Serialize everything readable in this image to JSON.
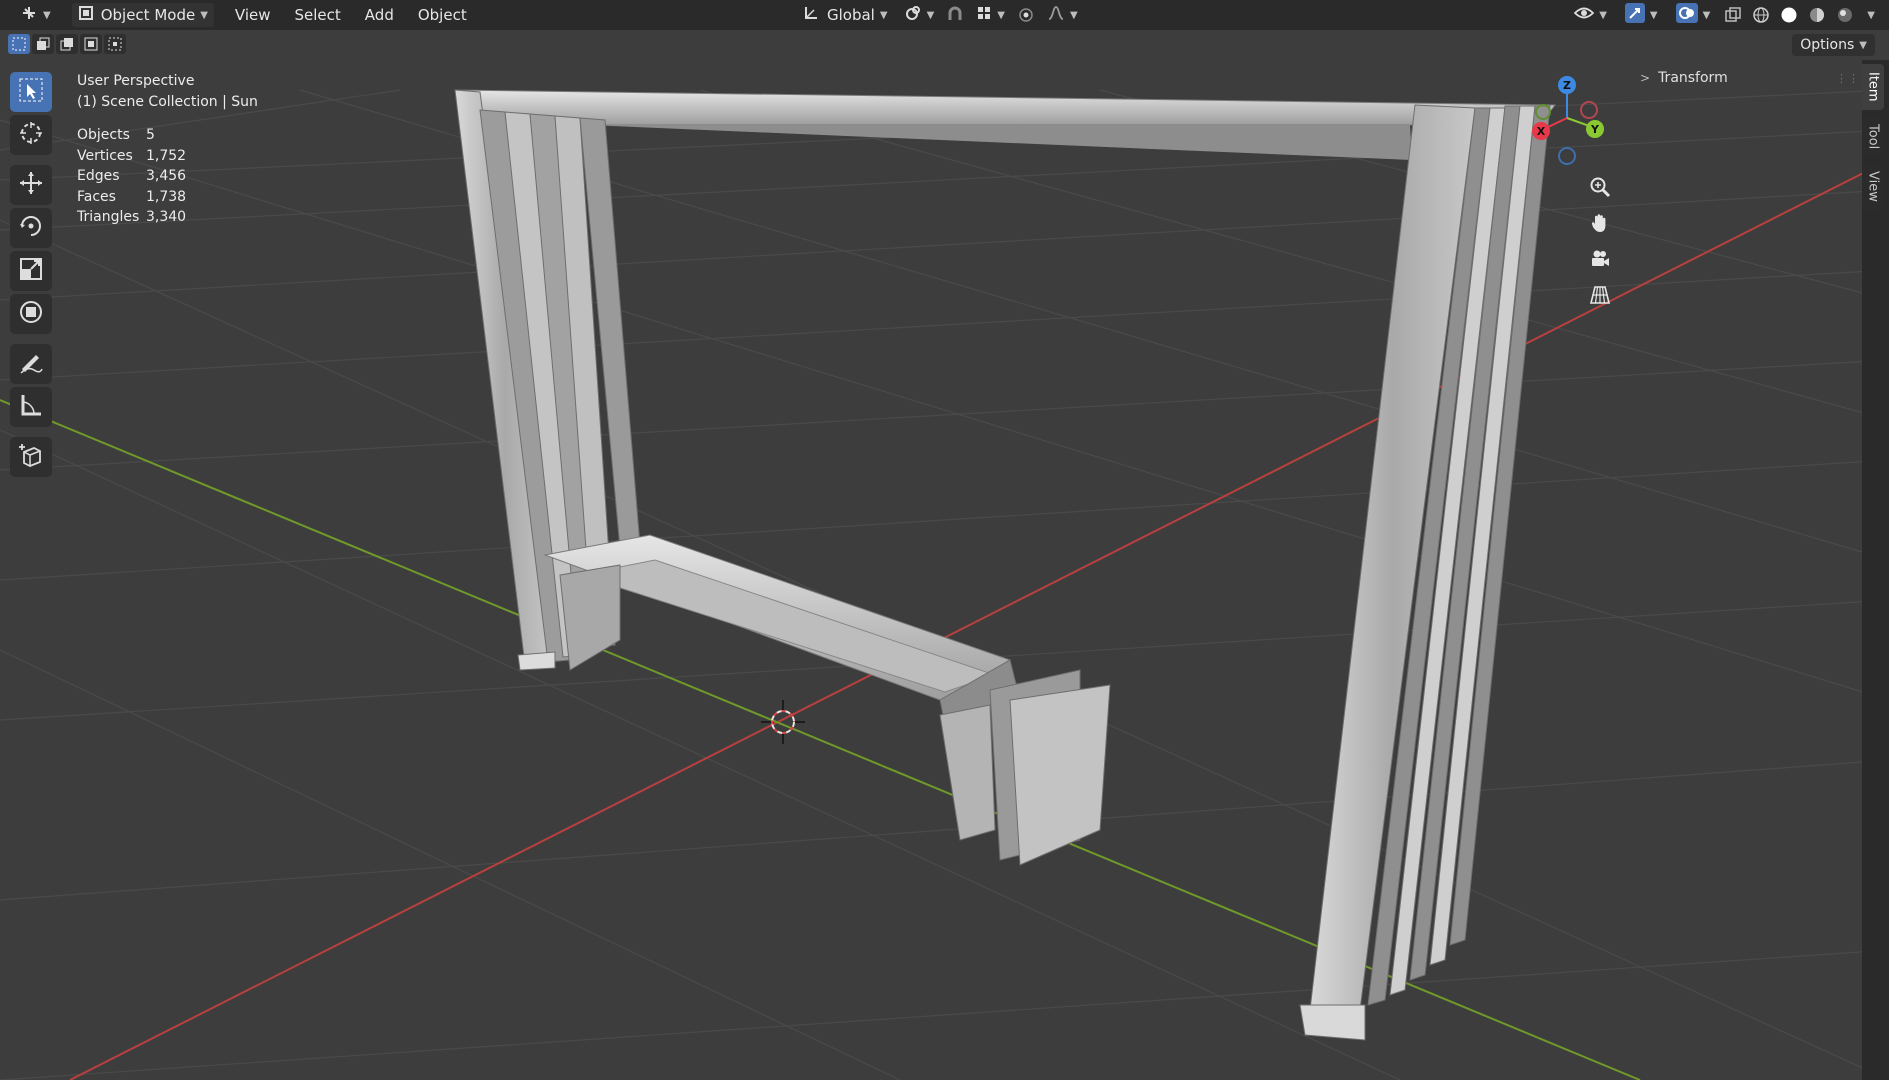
{
  "header": {
    "mode_label": "Object Mode",
    "menus": [
      "View",
      "Select",
      "Add",
      "Object"
    ],
    "transform_orientation": "Global"
  },
  "toolrow": {
    "options_label": "Options"
  },
  "overlay": {
    "perspective": "User Perspective",
    "collection": "(1) Scene Collection | Sun",
    "stats": [
      {
        "label": "Objects",
        "value": "5"
      },
      {
        "label": "Vertices",
        "value": "1,752"
      },
      {
        "label": "Edges",
        "value": "3,456"
      },
      {
        "label": "Faces",
        "value": "1,738"
      },
      {
        "label": "Triangles",
        "value": "3,340"
      }
    ]
  },
  "gizmo": {
    "x": "X",
    "y": "Y",
    "z": "Z"
  },
  "npanel": {
    "transform_label": "Transform",
    "tabs": [
      "Item",
      "Tool",
      "View"
    ]
  },
  "colors": {
    "background": "#3d3d3d",
    "grid": "#4a4a4a",
    "axis_x": "#b8403e",
    "axis_y": "#6f9a2a",
    "accent": "#4772b3",
    "gizmo_x": "#e8394b",
    "gizmo_y": "#8bc933",
    "gizmo_z": "#3e8ae3"
  }
}
